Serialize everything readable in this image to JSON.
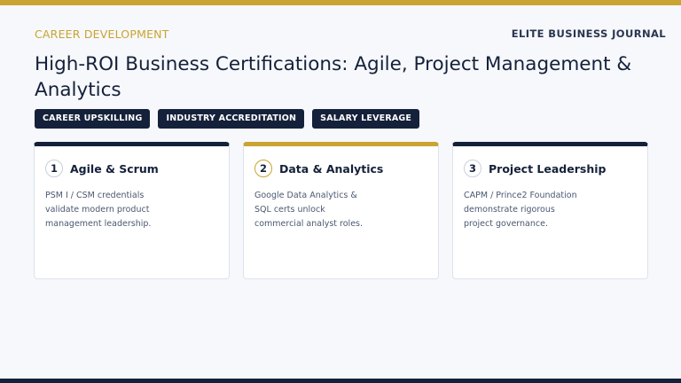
{
  "header": {
    "kicker": "CAREER DEVELOPMENT",
    "brand": "ELITE BUSINESS JOURNAL",
    "title": "High-ROI Business Certifications: Agile, Project Management & Analytics"
  },
  "tags": [
    "CAREER UPSKILLING",
    "INDUSTRY ACCREDITATION",
    "SALARY LEVERAGE"
  ],
  "cards": [
    {
      "number": "1",
      "title": "Agile & Scrum",
      "text": "PSM I / CSM credentials validate modern product management leadership."
    },
    {
      "number": "2",
      "title": "Data & Analytics",
      "text": "Google Data Analytics & SQL certs unlock commercial analyst roles."
    },
    {
      "number": "3",
      "title": "Project Leadership",
      "text": "CAPM / Prince2 Foundation demonstrate rigorous project governance."
    }
  ],
  "colors": {
    "navy": "#15213a",
    "gold": "#c9a432",
    "background": "#f6f8fb"
  }
}
